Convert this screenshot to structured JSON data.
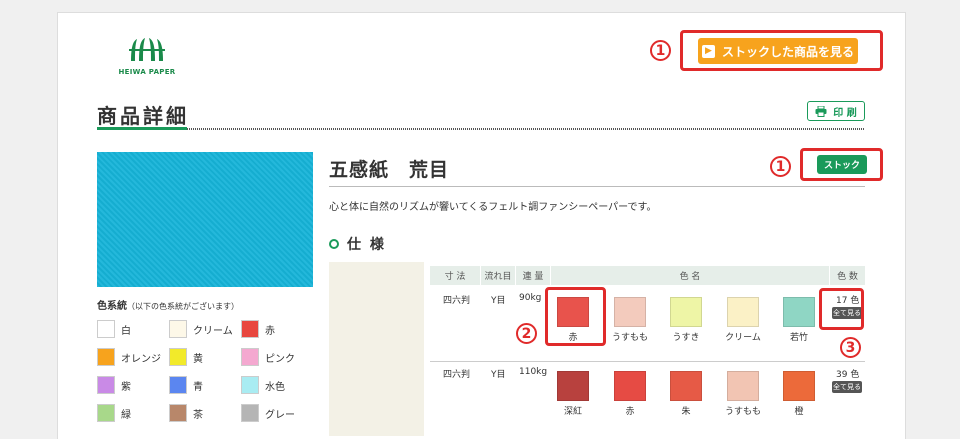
{
  "brand": {
    "logo_text": "HEIWA PAPER"
  },
  "header": {
    "stock_list_button": "ストックした商品を見る"
  },
  "page": {
    "title": "商品詳細",
    "print_label": "印 刷"
  },
  "callouts": {
    "one": "1",
    "two": "2",
    "three": "3"
  },
  "color_system": {
    "title": "色系統",
    "note": "（以下の色系統がございます）",
    "items": [
      {
        "label": "白",
        "color": "#ffffff"
      },
      {
        "label": "クリーム",
        "color": "#fdf8e8"
      },
      {
        "label": "赤",
        "color": "#e8473f"
      },
      {
        "label": "オレンジ",
        "color": "#f7a31d"
      },
      {
        "label": "黄",
        "color": "#f2ea2a"
      },
      {
        "label": "ピンク",
        "color": "#f4a8d0"
      },
      {
        "label": "紫",
        "color": "#c98ae6"
      },
      {
        "label": "青",
        "color": "#5b86f0"
      },
      {
        "label": "水色",
        "color": "#a9ecf2"
      },
      {
        "label": "緑",
        "color": "#a8d88a"
      },
      {
        "label": "茶",
        "color": "#b8876a"
      },
      {
        "label": "グレー",
        "color": "#b5b5b5"
      }
    ]
  },
  "product": {
    "name": "五感紙　荒目",
    "stock_button": "ストック",
    "description": "心と体に自然のリズムが響いてくるフェルト調ファンシーペーパーです。",
    "spec_title": "仕 様",
    "swatch_color": "#16b4d9"
  },
  "spec_table": {
    "headers": {
      "size": "寸 法",
      "grain": "流れ目",
      "weight": "連 量",
      "color_name": "色 名",
      "count": "色 数"
    },
    "rows": [
      {
        "size": "四六判",
        "grain": "Y目",
        "weight": "90kg",
        "count": "17 色",
        "all_button": "全て見る",
        "colors": [
          {
            "name": "赤",
            "hex": "#e8534c"
          },
          {
            "name": "うすもも",
            "hex": "#f3cbbd"
          },
          {
            "name": "うすき",
            "hex": "#eef5a6"
          },
          {
            "name": "クリーム",
            "hex": "#fbf1c6"
          },
          {
            "name": "若竹",
            "hex": "#8fd6c4"
          }
        ]
      },
      {
        "size": "四六判",
        "grain": "Y目",
        "weight": "110kg",
        "count": "39 色",
        "all_button": "全て見る",
        "colors": [
          {
            "name": "深紅",
            "hex": "#b8413e"
          },
          {
            "name": "赤",
            "hex": "#e64b44"
          },
          {
            "name": "朱",
            "hex": "#e65a46"
          },
          {
            "name": "うすもも",
            "hex": "#f2c5b3"
          },
          {
            "name": "橙",
            "hex": "#ec6a3a"
          }
        ]
      }
    ]
  }
}
